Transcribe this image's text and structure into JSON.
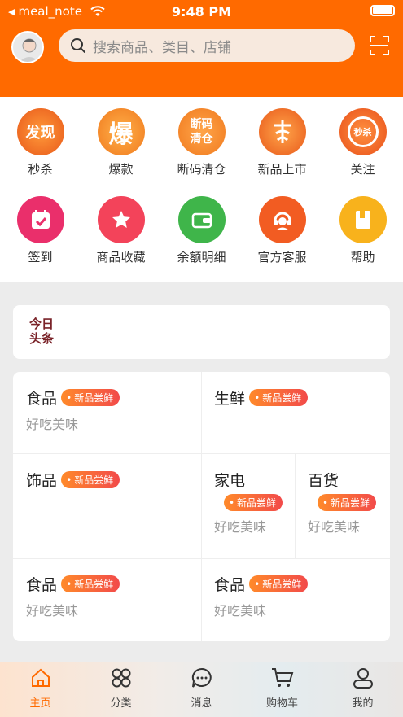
{
  "status_bar": {
    "back_label": "meal_note",
    "time": "9:48 PM"
  },
  "header": {
    "search_placeholder": "搜索商品、类目、店铺"
  },
  "grid": [
    {
      "label": "秒杀",
      "icon": "discover-icon",
      "icon_text": "发现",
      "color": "#f07a1e"
    },
    {
      "label": "爆款",
      "icon": "hot-icon",
      "icon_text": "爆",
      "color": "#f5882a"
    },
    {
      "label": "断码清仓",
      "icon": "clearance-icon",
      "icon_text": "断码清仓",
      "color": "#f58a2a"
    },
    {
      "label": "新品上市",
      "icon": "new-product-icon",
      "icon_text": "",
      "color": "#f07a1e"
    },
    {
      "label": "关注",
      "icon": "flash-sale-clock-icon",
      "icon_text": "秒杀",
      "color": "#f36a1e"
    },
    {
      "label": "签到",
      "icon": "calendar-check-icon",
      "icon_text": "",
      "color": "#ea2f6b"
    },
    {
      "label": "商品收藏",
      "icon": "star-icon",
      "icon_text": "",
      "color": "#f3435a"
    },
    {
      "label": "余额明细",
      "icon": "wallet-icon",
      "icon_text": "",
      "color": "#3fb54a"
    },
    {
      "label": "官方客服",
      "icon": "customer-service-icon",
      "icon_text": "",
      "color": "#f25c22"
    },
    {
      "label": "帮助",
      "icon": "book-icon",
      "icon_text": "",
      "color": "#f8b21c"
    }
  ],
  "headline": {
    "logo_line1": "今日",
    "logo_line2": "头条"
  },
  "products": [
    {
      "name": "食品",
      "tag": "新品尝鲜",
      "sub": "好吃美味"
    },
    {
      "name": "生鲜",
      "tag": "新品尝鲜",
      "sub": ""
    },
    {
      "name": "饰品",
      "tag": "新品尝鲜",
      "sub": ""
    },
    {
      "name": "家电",
      "tag": "新品尝鲜",
      "sub": "好吃美味"
    },
    {
      "name": "百货",
      "tag": "新品尝鲜",
      "sub": "好吃美味"
    },
    {
      "name": "食品",
      "tag": "新品尝鲜",
      "sub": "好吃美味"
    },
    {
      "name": "食品",
      "tag": "新品尝鲜",
      "sub": "好吃美味"
    }
  ],
  "tabs": [
    {
      "label": "主页",
      "icon": "home-icon",
      "active": true
    },
    {
      "label": "分类",
      "icon": "category-icon",
      "active": false
    },
    {
      "label": "消息",
      "icon": "message-icon",
      "active": false
    },
    {
      "label": "购物车",
      "icon": "cart-icon",
      "active": false
    },
    {
      "label": "我的",
      "icon": "profile-icon",
      "active": false
    }
  ],
  "colors": {
    "brand": "#ff6a00",
    "tag_start": "#ff8a2a",
    "tag_end": "#f24a4a"
  }
}
